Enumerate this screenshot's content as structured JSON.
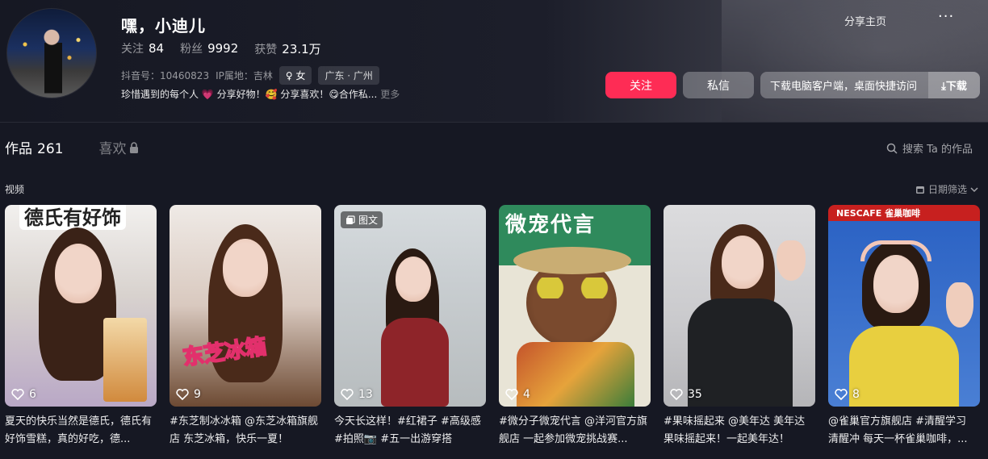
{
  "profile": {
    "name": "嘿，小迪儿",
    "stats": [
      {
        "label": "关注",
        "value": "84"
      },
      {
        "label": "粉丝",
        "value": "9992"
      },
      {
        "label": "获赞",
        "value": "23.1万"
      }
    ],
    "douyin_id": "抖音号：10460823",
    "ip": "IP属地：吉林",
    "gender_tag": "♀ 女",
    "location_tag": "广东 · 广州",
    "bio": "珍惜遇到的每个人 💗 分享好物！🥰 分享喜欢！😋合作私...",
    "bio_more": "更多"
  },
  "header_actions": {
    "share_home": "分享主页",
    "more": "···",
    "follow": "关注",
    "message": "私信",
    "download_text": "下载电脑客户端，桌面快捷访问",
    "download_action": "⤓下载"
  },
  "tabs": {
    "works_label": "作品",
    "works_count": "261",
    "likes_label": "喜欢",
    "search": "搜索 Ta 的作品"
  },
  "section": {
    "label": "视频",
    "date_filter": "日期筛选"
  },
  "videos": [
    {
      "likes": "6",
      "desc": "夏天的快乐当然是德氏，德氏有好饰雪糕，真的好吃，德...",
      "overlay": "德氏有好饰",
      "colors": [
        "#d7d2cf",
        "#bfa9c7"
      ]
    },
    {
      "likes": "9",
      "desc": "#东芝制冰冰箱 @东芝冰箱旗舰店 东芝冰箱，快乐一夏！",
      "overlay": "东芝冰箱",
      "colors": [
        "#eae6e2",
        "#6a4a35"
      ]
    },
    {
      "likes": "13",
      "desc": "今天长这样！#红裙子 #高级感 #拍照📷 #五一出游穿搭",
      "badge": "图文",
      "colors": [
        "#cfd3d6",
        "#8f2b2b"
      ]
    },
    {
      "likes": "4",
      "desc": "#微分子微宠代言 @洋河官方旗舰店 一起参加微宠挑战赛...",
      "overlay": "微宠代言",
      "colors": [
        "#2f8a5c",
        "#e7e3d6"
      ]
    },
    {
      "likes": "35",
      "desc": "#果味摇起来 @美年达 美年达果味摇起来！一起美年达！",
      "colors": [
        "#d4d4d6",
        "#2a2a2e"
      ]
    },
    {
      "likes": "8",
      "desc": "@雀巢官方旗舰店 #清醒学习 清醒冲 每天一杯雀巢咖啡，...",
      "overlay": "NESCAFE 雀巢咖啡",
      "colors": [
        "#c7201f",
        "#2c63c4"
      ]
    }
  ]
}
